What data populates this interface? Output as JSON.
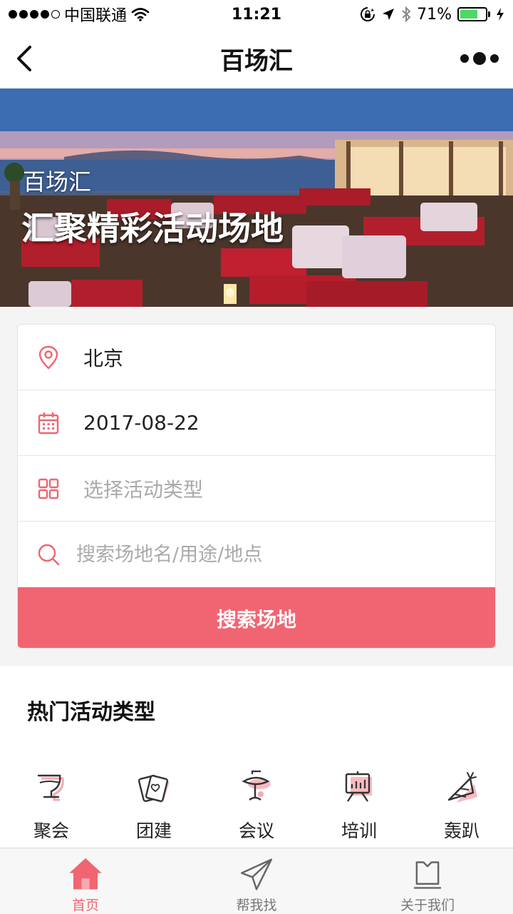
{
  "status_bar": {
    "carrier": "中国联通",
    "time": "11:21",
    "battery": "71%",
    "battery_level": 0.71
  },
  "nav": {
    "title": "百场汇"
  },
  "hero": {
    "subtitle": "百场汇",
    "title": "汇聚精彩活动场地"
  },
  "search": {
    "city": "北京",
    "date": "2017-08-22",
    "activity_type_placeholder": "选择活动类型",
    "keyword_placeholder": "搜索场地名/用途/地点",
    "button_label": "搜索场地"
  },
  "hot": {
    "title": "热门活动类型",
    "categories": [
      {
        "label": "聚会",
        "icon": "wine-glass-icon"
      },
      {
        "label": "团建",
        "icon": "playing-cards-icon"
      },
      {
        "label": "会议",
        "icon": "meeting-lamp-icon"
      },
      {
        "label": "培训",
        "icon": "presentation-board-icon"
      },
      {
        "label": "轰趴",
        "icon": "party-hat-icon"
      }
    ]
  },
  "tabs": [
    {
      "label": "首页",
      "icon": "home-icon",
      "active": true
    },
    {
      "label": "帮我找",
      "icon": "paper-plane-icon",
      "active": false
    },
    {
      "label": "关于我们",
      "icon": "about-icon",
      "active": false
    }
  ],
  "colors": {
    "accent": "#f06571",
    "icon_shadow": "#f7a9b0"
  }
}
